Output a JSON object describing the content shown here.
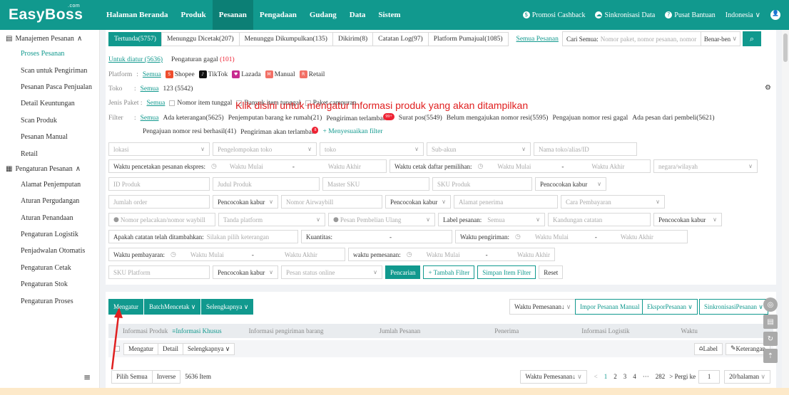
{
  "brand": {
    "logo": "EasyBoss",
    "logo_sup": ".com",
    "primary": "#11998e"
  },
  "nav": [
    "Halaman Beranda",
    "Produk",
    "Pesanan",
    "Pengadaan",
    "Gudang",
    "Data",
    "Sistem"
  ],
  "top_right": {
    "promo": "Promosi Cashback",
    "sync": "Sinkronisasi Data",
    "help": "Pusat Bantuan",
    "lang": "Indonesia"
  },
  "sidebar": {
    "group1": "Manajemen Pesanan",
    "items1": [
      "Proses Pesanan",
      "Scan untuk Pengiriman",
      "Pesanan Pasca Penjualan",
      "Detail Keuntungan",
      "Scan Produk",
      "Pesanan Manual",
      "Retail"
    ],
    "group2": "Pengaturan Pesanan",
    "items2": [
      "Alamat Penjemputan",
      "Aturan Pergudangan",
      "Aturan Penandaan",
      "Pengaturan Logistik",
      "Penjadwalan Otomatis",
      "Pengaturan Cetak",
      "Pengaturan Stok",
      "Pengaturan Proses"
    ]
  },
  "tabs": [
    "Tertunda(5757)",
    "Menunggu Dicetak(207)",
    "Menunggu Dikumpulkan(135)",
    "Dikirim(8)",
    "Catatan Log(97)",
    "Platform Pumajual(1085)"
  ],
  "tab_link": "Semua Pesanan",
  "search": {
    "label": "Cari Semua:",
    "placeholder": "Nomor paket, nomor pesanan, nomor",
    "match": "Benar-ben"
  },
  "subtabs": {
    "a": "Untuk diatur (5636)",
    "b": "Pengaturan gagal",
    "b_count": "(101)"
  },
  "platform": {
    "label": "Platform",
    "all": "Semua",
    "items": [
      "Shopee",
      "TikTok",
      "Lazada",
      "Manual",
      "Retail"
    ]
  },
  "toko": {
    "label": "Toko",
    "all": "Semua",
    "value": "123 (5542)"
  },
  "paket": {
    "label": "Jenis Paket :",
    "all": "Semua",
    "opts": [
      "Nomor item tunggal",
      "Banyak item tunggal",
      "Paket campuran"
    ]
  },
  "filter": {
    "label": "Filter",
    "all": "Semua",
    "items": [
      "Ada keterangan(5625)",
      "Penjemputan barang ke rumah(21)",
      "Pengiriman terlambat",
      "Surat pos(5549)",
      "Belum mengajukan nomor resi(5595)",
      "Pengajuan nomor resi gagal",
      "Ada pesan dari pembeli(5621)"
    ],
    "badge1": "99+",
    "items2": [
      "Pengajuan nomor resi berhasil(41)",
      "Pengiriman akan terlambat"
    ],
    "badge2": "8",
    "custom": "+ Menyesuaikan filter"
  },
  "f1": [
    "lokasi",
    "Pengelompokan toko",
    "toko",
    "Sub-akun",
    "Nama toko/alias/ID"
  ],
  "f2": {
    "ekspres": "Waktu pencetakan pesanan ekspres:",
    "mulai": "Waktu Mulai",
    "akhir": "Waktu Akhir",
    "dash": "-",
    "daftar": "Waktu cetak daftar pemilihan:",
    "negara": "negara/wilayah"
  },
  "f3": [
    "ID Produk",
    "Judul Produk",
    "Master SKU",
    "SKU Produk",
    "Pencocokan kabur"
  ],
  "f4": [
    "Jumlah order",
    "Pencocokan kabur",
    "Nomor Airwaybill",
    "Pencocokan kabur",
    "Alamat penerima",
    "Cara Pembayaran"
  ],
  "f5": {
    "a": "Nomor pelacakan/nomor waybill",
    "b": "Tanda platform",
    "c": "Pesan Pembelian Ulang",
    "d": "Label pesanan:",
    "e": "Semua",
    "f": "Kandungan catatan",
    "g": "Pencocokan kabur"
  },
  "f6": {
    "a": "Apakah catatan telah ditambahkan:",
    "b": "Silakan pilih keterangan",
    "c": "Kuantitas:",
    "d": "Waktu pengiriman:"
  },
  "f7": {
    "a": "Waktu pembayaran:",
    "b": "waktu pemesanan:"
  },
  "f8": {
    "a": "SKU Platform",
    "b": "Pencocokan kabur",
    "c": "Pesan status online",
    "search": "Pencarian",
    "add": "+ Tambah Filter",
    "save": "Simpan Item Filter",
    "reset": "Reset"
  },
  "actions": {
    "mengatur": "Mengatur",
    "batch": "BatchMencetak",
    "lain": "Selengkapnya",
    "sort": "Waktu Pemesanan↓",
    "impor": "Impor Pesanan Manual",
    "ekspor": "EksporPesanan",
    "sinkron": "SinkronisasiPesanan"
  },
  "thead": [
    "Informasi Produk",
    "≡Informasi Khusus",
    "Informasi pengiriman barang",
    "Jumlah Pesanan",
    "Penerima",
    "Informasi Logistik",
    "Waktu"
  ],
  "subrow": {
    "a": "Mengatur",
    "b": "Detail",
    "c": "Selengkapnya",
    "label": "Label",
    "ket": "Keterangan"
  },
  "pager": {
    "all": "Pilih Semua",
    "inv": "Inverse",
    "count": "5636 Item",
    "sort": "Waktu Pemesanan↓",
    "p1": "1",
    "p2": "2",
    "p3": "3",
    "p4": "4",
    "dots": "···",
    "last": "282",
    "goto": "> Pergi ke",
    "goto_val": "1",
    "per": "20/halaman"
  },
  "annotation": "Klik disini untuk mengatur informasi produk yang akan ditampilkan"
}
